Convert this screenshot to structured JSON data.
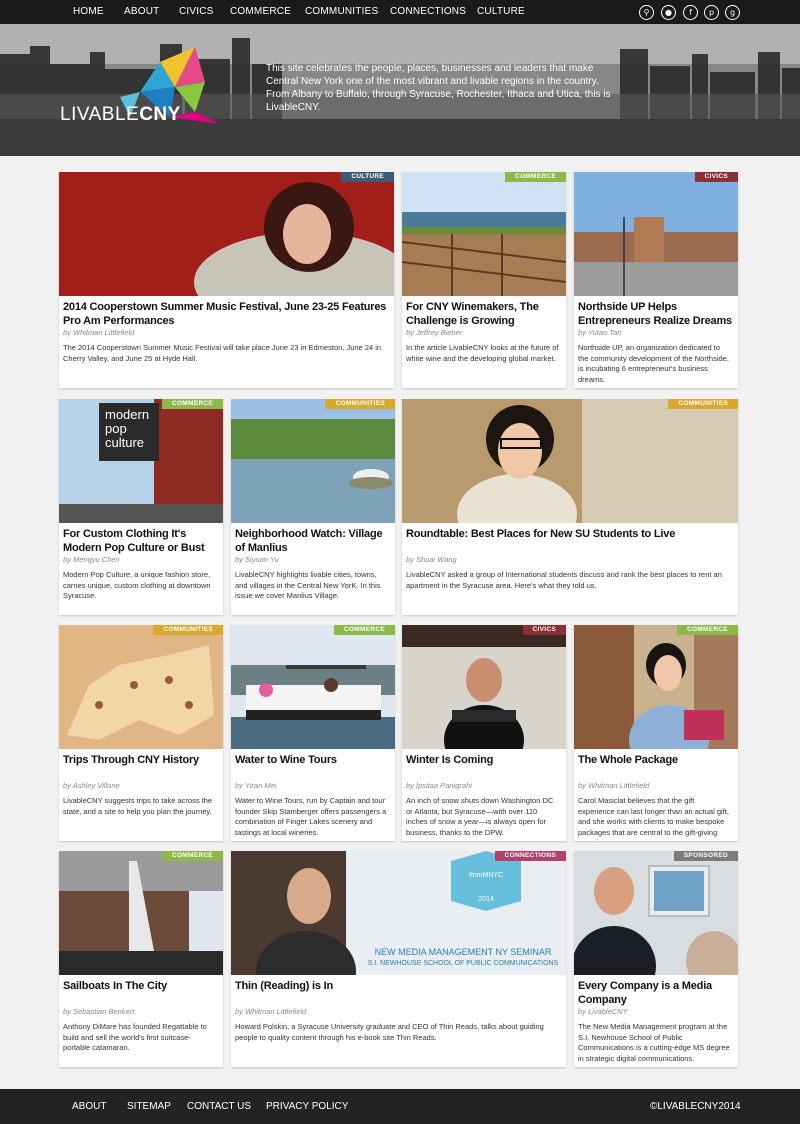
{
  "nav": {
    "items": [
      "HOME",
      "ABOUT",
      "CIVICS",
      "COMMERCE",
      "COMMUNITIES",
      "CONNECTIONS",
      "CULTURE"
    ],
    "social_icons": [
      "search-icon",
      "twitter-icon",
      "facebook-icon",
      "pinterest-icon",
      "googleplus-icon"
    ]
  },
  "hero": {
    "logo_text_light": "LIVABLE",
    "logo_text_bold": "CNY",
    "tagline": "This site celebrates the people, places, businesses and leaders that make Central New York one of the most vibrant and livable regions in the country. From Albany to Buffalo, through Syracuse, Rochester, Ithaca and Utica, this is LivableCNY."
  },
  "colors": {
    "culture": "#3d5a78",
    "commerce": "#8db84a",
    "civics": "#8a3038",
    "communities": "#d9a92f",
    "connections": "#b2416a",
    "sponsored": "#7c7c7c"
  },
  "cards": [
    {
      "badge": "CULTURE",
      "title": "2014 Cooperstown Summer Music Festival, June 23-25 Features Pro Am Performances",
      "author": "by Whitman Littlefield",
      "desc": "The 2014 Cooperstown Summer Music Festival will take place June 23 in Edmeston, June 24 in Cherry Valley, and June 25 at Hyde Hall."
    },
    {
      "badge": "COMMERCE",
      "title": "For CNY Winemakers, The Challenge is Growing",
      "author": "by Jeffrey Bieber",
      "desc": "In the article LivableCNY looks at the future of white wine and the developing global market."
    },
    {
      "badge": "CIVICS",
      "title": "Northside UP Helps Entrepreneurs Realize Dreams",
      "author": "by Yutao Tan",
      "desc": "Northside UP, an organization dedicated to the community development of the Northside, is incubating 6 entrepreneur's business dreams."
    },
    {
      "badge": "COMMERCE",
      "title": "For Custom Clothing It's Modern Pop Culture or Bust",
      "author": "by Mengyu Chen",
      "desc": "Modern Pop Culture, a unique fashion store, carries unique, custom clothing at downtown Syracuse."
    },
    {
      "badge": "COMMUNITIES",
      "title": "Neighborhood Watch: Village of Manlius",
      "author": "by Siyuan Yu",
      "desc": "LivableCNY highlights livable cities, towns, and villages in the Central New YorK. In this issue we cover Manlius Village."
    },
    {
      "badge": "COMMUNITIES",
      "title": "Roundtable: Best Places for New SU Students to Live",
      "author": "by Shuai Wang",
      "desc": "LivableCNY asked a group of International students discuss and rank the best places to rent an apartment in the Syracuse area. Here's what they told us."
    },
    {
      "badge": "COMMUNITIES",
      "title": "Trips Through CNY History",
      "author": "by Ashley Villone",
      "desc": "LivableCNY suggests trips to take across the state, and a site to help you plan the journey."
    },
    {
      "badge": "COMMERCE",
      "title": "Water to Wine Tours",
      "author": "by Yiran Mei",
      "desc": "Water to Wine Tours, run by Captain and tour founder Skip Stamberger offers passengers a combination of Finger Lakes scenery and tastings at local wineries."
    },
    {
      "badge": "CIVICS",
      "title": "Winter Is Coming",
      "author": "by Ipsitaa Panigrahi",
      "desc": "An inch of snow shuts down Washington DC or Atlanta, but Syracuse—with over 110 inches of snow a year—is always open for business, thanks to the DPW."
    },
    {
      "badge": "COMMERCE",
      "title": "The Whole Package",
      "author": "by Whitman Littlefield",
      "desc": "Carol Masiclat believes that the gift experience can last longer than an actual gift, and she works with clients to make bespoke packages that are central to the gift-giving experience."
    },
    {
      "badge": "COMMERCE",
      "title": "Sailboats In The City",
      "author": "by Sebastian Benkert",
      "desc": "Anthony DiMare has founded Regattable to build and sell the world's first suitcase-portable catamaran."
    },
    {
      "badge": "CONNECTIONS",
      "title": "Thin (Reading) is In",
      "author": "by Whitman Littlefield",
      "desc": "Howard Polskin, a Syracuse University graduate and CEO of Thin Reads, talks about guiding people to quality content through his e-book site Thin Reads.",
      "img_text_1": "#nmMNYC",
      "img_text_2": "2014",
      "img_text_3": "NEW MEDIA MANAGEMENT NY SEMINAR",
      "img_text_4": "S.I. NEWHOUSE SCHOOL OF PUBLIC COMMUNICATIONS"
    },
    {
      "badge": "SPONSORED",
      "title": "Every Company is a Media Company",
      "author": "by LivableCNY",
      "desc": "The New Media Management program at the S.I. Newhouse School of Public Communications is a cutting-edge MS degree in strategic digital communications."
    }
  ],
  "card4_sign": {
    "line1": "modern",
    "line2": "pop",
    "line3": "culture"
  },
  "footer": {
    "items": [
      "ABOUT",
      "SITEMAP",
      "CONTACT US",
      "PRIVACY POLICY"
    ],
    "copyright": "©LIVABLECNY2014"
  }
}
